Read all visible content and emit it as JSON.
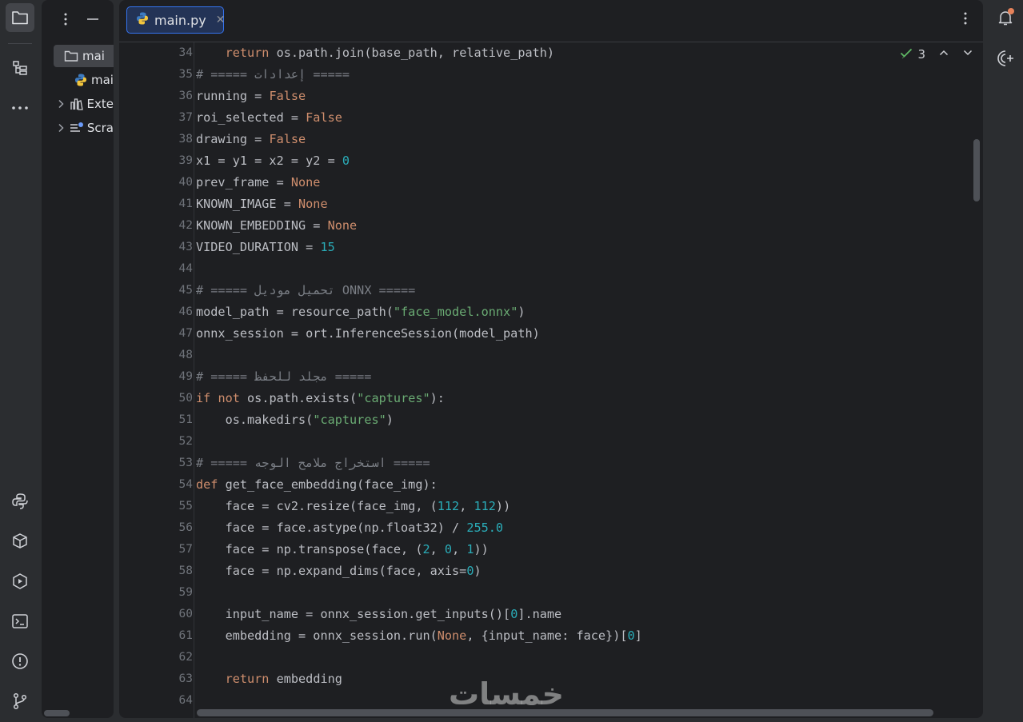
{
  "left_strip": {
    "top_icons": [
      "folder-icon",
      "structure-icon",
      "more-icon"
    ],
    "bottom_icons": [
      "python-console-icon",
      "python-packages-icon",
      "run-icon",
      "terminal-icon",
      "problems-icon",
      "git-icon"
    ]
  },
  "project_panel": {
    "items": [
      {
        "label": "mai",
        "icon": "folder-icon",
        "selected": true
      },
      {
        "label": "mai",
        "icon": "python-file-icon",
        "selected": false
      },
      {
        "label": "Exte",
        "icon": "external-libraries-icon",
        "selected": false
      },
      {
        "label": "Scra",
        "icon": "scratches-icon",
        "selected": false
      }
    ]
  },
  "editor": {
    "tab": {
      "label": "main.py",
      "close_glyph": "✕"
    },
    "inspection_count": "3",
    "gutter": [
      "34",
      "35",
      "36",
      "37",
      "38",
      "39",
      "40",
      "41",
      "42",
      "43",
      "44",
      "45",
      "46",
      "47",
      "48",
      "49",
      "50",
      "51",
      "52",
      "53",
      "54",
      "55",
      "56",
      "57",
      "58",
      "59",
      "60",
      "61",
      "62",
      "63",
      "64"
    ],
    "lines": [
      {
        "indent": "    ",
        "tokens": [
          {
            "t": "return",
            "c": "kw"
          },
          {
            "t": " os.path.join(base_path, relative_path)"
          }
        ]
      },
      {
        "indent": "",
        "tokens": [
          {
            "t": "# ===== إعدادات =====",
            "c": "cmt"
          }
        ]
      },
      {
        "indent": "",
        "tokens": [
          {
            "t": "running = "
          },
          {
            "t": "False",
            "c": "kw"
          }
        ]
      },
      {
        "indent": "",
        "tokens": [
          {
            "t": "roi_selected = "
          },
          {
            "t": "False",
            "c": "kw"
          }
        ]
      },
      {
        "indent": "",
        "tokens": [
          {
            "t": "drawing = "
          },
          {
            "t": "False",
            "c": "kw"
          }
        ]
      },
      {
        "indent": "",
        "tokens": [
          {
            "t": "x1 = y1 = x2 = y2 = "
          },
          {
            "t": "0",
            "c": "num"
          }
        ]
      },
      {
        "indent": "",
        "tokens": [
          {
            "t": "prev_frame = "
          },
          {
            "t": "None",
            "c": "kw"
          }
        ]
      },
      {
        "indent": "",
        "tokens": [
          {
            "t": "KNOWN_IMAGE = "
          },
          {
            "t": "None",
            "c": "kw"
          }
        ]
      },
      {
        "indent": "",
        "tokens": [
          {
            "t": "KNOWN_EMBEDDING = "
          },
          {
            "t": "None",
            "c": "kw"
          }
        ]
      },
      {
        "indent": "",
        "tokens": [
          {
            "t": "VIDEO_DURATION = "
          },
          {
            "t": "15",
            "c": "num"
          }
        ]
      },
      {
        "indent": "",
        "tokens": []
      },
      {
        "indent": "",
        "tokens": [
          {
            "t": "# ===== تحميل موديل ONNX =====",
            "c": "cmt"
          }
        ]
      },
      {
        "indent": "",
        "tokens": [
          {
            "t": "model_path = resource_path("
          },
          {
            "t": "\"face_model.onnx\"",
            "c": "str"
          },
          {
            "t": ")"
          }
        ]
      },
      {
        "indent": "",
        "tokens": [
          {
            "t": "onnx_session = ort.InferenceSession(model_path)"
          }
        ]
      },
      {
        "indent": "",
        "tokens": []
      },
      {
        "indent": "",
        "tokens": [
          {
            "t": "# ===== مجلد للحفظ =====",
            "c": "cmt"
          }
        ]
      },
      {
        "indent": "",
        "tokens": [
          {
            "t": "if",
            "c": "kw"
          },
          {
            "t": " "
          },
          {
            "t": "not",
            "c": "kw"
          },
          {
            "t": " os.path.exists("
          },
          {
            "t": "\"captures\"",
            "c": "str"
          },
          {
            "t": "):"
          }
        ]
      },
      {
        "indent": "    ",
        "tokens": [
          {
            "t": "os.makedirs("
          },
          {
            "t": "\"captures\"",
            "c": "str"
          },
          {
            "t": ")"
          }
        ]
      },
      {
        "indent": "",
        "tokens": []
      },
      {
        "indent": "",
        "tokens": [
          {
            "t": "# ===== استخراج ملامح الوجه =====",
            "c": "cmt"
          }
        ]
      },
      {
        "indent": "",
        "tokens": [
          {
            "t": "def",
            "c": "kw"
          },
          {
            "t": " get_face_embedding(face_img):"
          }
        ]
      },
      {
        "indent": "    ",
        "tokens": [
          {
            "t": "face = cv2.resize(face_img, ("
          },
          {
            "t": "112",
            "c": "num"
          },
          {
            "t": ", "
          },
          {
            "t": "112",
            "c": "num"
          },
          {
            "t": "))"
          }
        ]
      },
      {
        "indent": "    ",
        "tokens": [
          {
            "t": "face = face.astype(np.float32) / "
          },
          {
            "t": "255.0",
            "c": "num"
          }
        ]
      },
      {
        "indent": "    ",
        "tokens": [
          {
            "t": "face = np.transpose(face, ("
          },
          {
            "t": "2",
            "c": "num"
          },
          {
            "t": ", "
          },
          {
            "t": "0",
            "c": "num"
          },
          {
            "t": ", "
          },
          {
            "t": "1",
            "c": "num"
          },
          {
            "t": "))"
          }
        ]
      },
      {
        "indent": "    ",
        "tokens": [
          {
            "t": "face = np.expand_dims(face, axis="
          },
          {
            "t": "0",
            "c": "num"
          },
          {
            "t": ")"
          }
        ]
      },
      {
        "indent": "",
        "tokens": []
      },
      {
        "indent": "    ",
        "tokens": [
          {
            "t": "input_name = onnx_session.get_inputs()["
          },
          {
            "t": "0",
            "c": "num"
          },
          {
            "t": "].name"
          }
        ]
      },
      {
        "indent": "    ",
        "tokens": [
          {
            "t": "embedding = onnx_session.run("
          },
          {
            "t": "None",
            "c": "kw"
          },
          {
            "t": ", {input_name: face})["
          },
          {
            "t": "0",
            "c": "num"
          },
          {
            "t": "]"
          }
        ]
      },
      {
        "indent": "",
        "tokens": []
      },
      {
        "indent": "    ",
        "tokens": [
          {
            "t": "return",
            "c": "kw"
          },
          {
            "t": " embedding"
          }
        ]
      },
      {
        "indent": "",
        "tokens": []
      }
    ]
  },
  "right_strip": {
    "icons": [
      "notifications-icon",
      "ai-assistant-icon"
    ]
  },
  "watermark": "خمسات",
  "colors": {
    "keyword": "#cf8e6d",
    "number": "#2aacb8",
    "string": "#6aab73",
    "comment": "#7a7e85",
    "text": "#bcbec4",
    "accent": "#3574f0"
  }
}
